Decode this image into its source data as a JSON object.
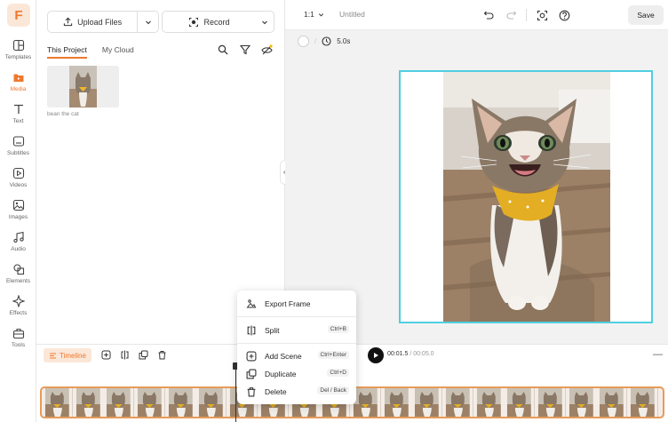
{
  "brand": {
    "logo_letter": "F",
    "accent": "#f0782d"
  },
  "rail": {
    "items": [
      {
        "label": "Templates",
        "icon": "templates-icon"
      },
      {
        "label": "Media",
        "icon": "media-icon",
        "active": true
      },
      {
        "label": "Text",
        "icon": "text-icon"
      },
      {
        "label": "Subtitles",
        "icon": "subtitles-icon"
      },
      {
        "label": "Videos",
        "icon": "videos-icon"
      },
      {
        "label": "Images",
        "icon": "images-icon"
      },
      {
        "label": "Audio",
        "icon": "audio-icon"
      },
      {
        "label": "Elements",
        "icon": "elements-icon"
      },
      {
        "label": "Effects",
        "icon": "effects-icon"
      },
      {
        "label": "Tools",
        "icon": "tools-icon"
      }
    ]
  },
  "panel": {
    "upload_label": "Upload Files",
    "record_label": "Record",
    "tabs": [
      {
        "label": "This Project"
      },
      {
        "label": "My Cloud"
      }
    ],
    "media": [
      {
        "caption": "bean the cat"
      }
    ]
  },
  "toolbar": {
    "ratio": "1:1",
    "doc_title": "Untitled",
    "save_label": "Save"
  },
  "scene": {
    "duration": "5.0s"
  },
  "timeline": {
    "tab_label": "Timeline",
    "current_time": "00:01.5",
    "total_time": "/ 00:05.0",
    "clip_count": 20
  },
  "context_menu": {
    "items": [
      {
        "label": "Export Frame",
        "shortcut": ""
      },
      {
        "label": "Split",
        "shortcut": "Ctrl+B"
      },
      {
        "label": "Add Scene",
        "shortcut": "Ctrl+Enter"
      },
      {
        "label": "Duplicate",
        "shortcut": "Ctrl+D"
      },
      {
        "label": "Delete",
        "shortcut": "Del / Back"
      }
    ]
  }
}
